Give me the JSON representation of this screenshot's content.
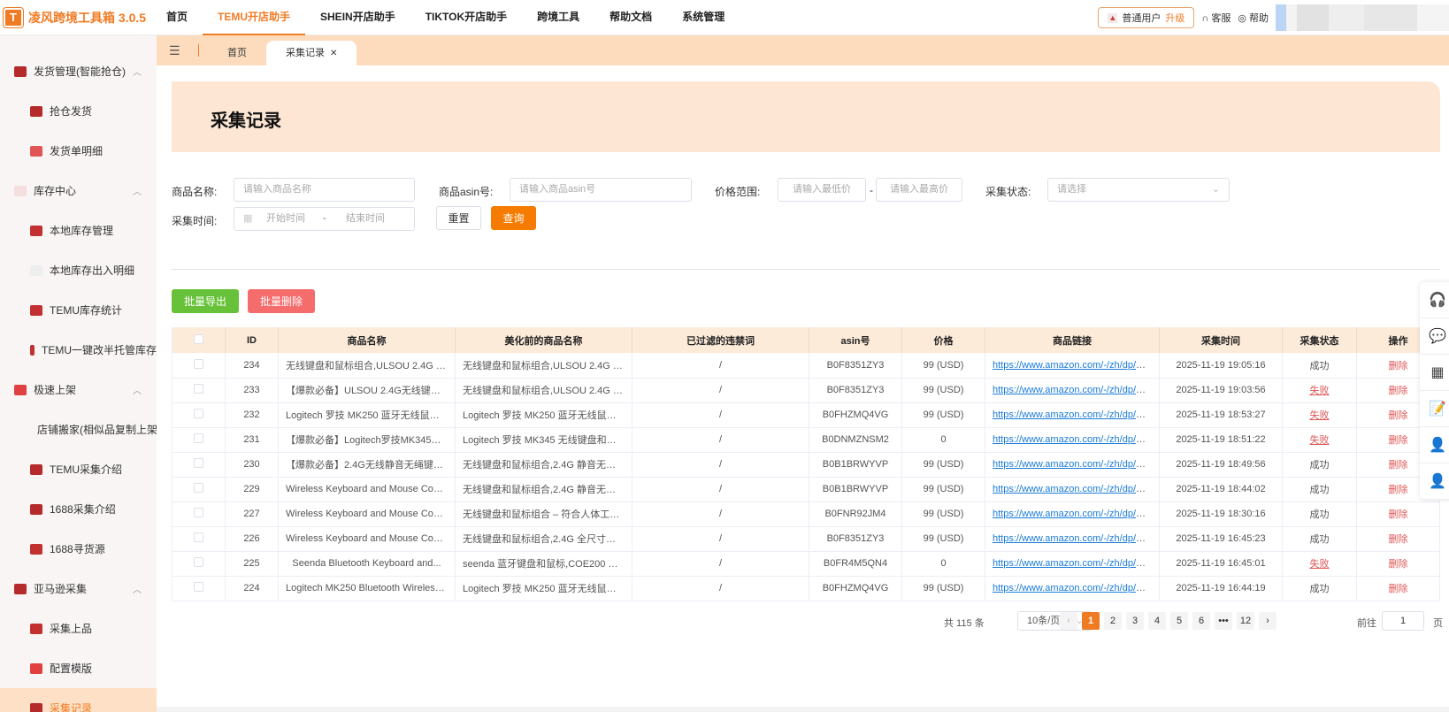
{
  "app": {
    "logo_letter": "T",
    "title": "凌风跨境工具箱 3.0.5"
  },
  "topnav": [
    {
      "label": "首页",
      "active": false
    },
    {
      "label": "TEMU开店助手",
      "active": true
    },
    {
      "label": "SHEIN开店助手",
      "active": false
    },
    {
      "label": "TIKTOK开店助手",
      "active": false
    },
    {
      "label": "跨境工具",
      "active": false
    },
    {
      "label": "帮助文档",
      "active": false
    },
    {
      "label": "系统管理",
      "active": false
    }
  ],
  "user": {
    "role": "普通用户",
    "upgrade": "升级",
    "service": "客服",
    "help": "帮助"
  },
  "sidebar": [
    {
      "label": "发货管理(智能抢仓)",
      "type": "group",
      "icon": "shipping-icon",
      "expanded": true
    },
    {
      "label": "抢仓发货",
      "type": "child",
      "icon": "box-icon"
    },
    {
      "label": "发货单明细",
      "type": "child",
      "icon": "chart-icon"
    },
    {
      "label": "库存中心",
      "type": "group",
      "icon": "list-icon",
      "expanded": true
    },
    {
      "label": "本地库存管理",
      "type": "child",
      "icon": "warehouse-icon"
    },
    {
      "label": "本地库存出入明细",
      "type": "child",
      "icon": "inout-icon"
    },
    {
      "label": "TEMU库存统计",
      "type": "child",
      "icon": "stats-icon"
    },
    {
      "label": "TEMU一键改半托管库存",
      "type": "child",
      "icon": "stats-icon"
    },
    {
      "label": "极速上架",
      "type": "group",
      "icon": "upload-icon",
      "expanded": true
    },
    {
      "label": "店铺搬家(相似品复制上架)",
      "type": "child",
      "icon": "copy-icon"
    },
    {
      "label": "TEMU采集介绍",
      "type": "child",
      "icon": "collect-icon"
    },
    {
      "label": "1688采集介绍",
      "type": "child",
      "icon": "collect-icon"
    },
    {
      "label": "1688寻货源",
      "type": "child",
      "icon": "source-icon"
    },
    {
      "label": "亚马逊采集",
      "type": "group",
      "icon": "collect-icon",
      "expanded": true
    },
    {
      "label": "采集上品",
      "type": "child",
      "icon": "source-icon"
    },
    {
      "label": "配置模版",
      "type": "child",
      "icon": "upload-icon"
    },
    {
      "label": "采集记录",
      "type": "child",
      "icon": "collect-icon",
      "active": true
    }
  ],
  "tabs": [
    {
      "label": "首页",
      "active": false
    },
    {
      "label": "采集记录",
      "active": true,
      "closable": true
    }
  ],
  "page": {
    "title": "采集记录"
  },
  "filters": {
    "name_label": "商品名称:",
    "name_placeholder": "请输入商品名称",
    "asin_label": "商品asin号:",
    "asin_placeholder": "请输入商品asin号",
    "price_label": "价格范围:",
    "price_min_placeholder": "请输入最低价",
    "price_sep": "-",
    "price_max_placeholder": "请输入最高价",
    "status_label": "采集状态:",
    "status_placeholder": "请选择",
    "time_label": "采集时间:",
    "time_start": "开始时间",
    "time_sep": "-",
    "time_end": "结束时间",
    "reset": "重置",
    "query": "查询"
  },
  "actions": {
    "export": "批量导出",
    "delete": "批量删除"
  },
  "table": {
    "headers": [
      "ID",
      "商品名称",
      "美化前的商品名称",
      "已过滤的违禁词",
      "asin号",
      "价格",
      "商品链接",
      "采集时间",
      "采集状态",
      "操作"
    ],
    "rows": [
      {
        "id": "234",
        "name": "无线键盘和鼠标组合,ULSOU 2.4G 全...",
        "orig": "无线键盘和鼠标组合,ULSOU 2.4G 全...",
        "filtered": "/",
        "asin": "B0F8351ZY3",
        "price": "99  (USD)",
        "link": "https://www.amazon.com/-/zh/dp/B0D...",
        "time": "2025-11-19 19:05:16",
        "status": "成功",
        "op": "删除"
      },
      {
        "id": "233",
        "name": "【爆款必备】ULSOU 2.4G无线键盘鼠...",
        "orig": "无线键盘和鼠标组合,ULSOU 2.4G 全...",
        "filtered": "/",
        "asin": "B0F8351ZY3",
        "price": "99  (USD)",
        "link": "https://www.amazon.com/-/zh/dp/B0D...",
        "time": "2025-11-19 19:03:56",
        "status": "失败",
        "op": "删除"
      },
      {
        "id": "232",
        "name": "Logitech 罗技 MK250 蓝牙无线鼠标和...",
        "orig": "Logitech 罗技 MK250 蓝牙无线鼠标和...",
        "filtered": "/",
        "asin": "B0FHZMQ4VG",
        "price": "99  (USD)",
        "link": "https://www.amazon.com/-/zh/dp/B0F...",
        "time": "2025-11-19 18:53:27",
        "status": "失败",
        "op": "删除"
      },
      {
        "id": "231",
        "name": "【爆款必备】Logitech罗技MK345无线...",
        "orig": "Logitech 罗技 MK345 无线键盘和鼠标...",
        "filtered": "/",
        "asin": "B0DNMZNSM2",
        "price": "0",
        "link": "https://www.amazon.com/-/zh/dp/B0D...",
        "time": "2025-11-19 18:51:22",
        "status": "失败",
        "op": "删除"
      },
      {
        "id": "230",
        "name": "【爆款必备】2.4G无线静音无绳键盘...",
        "orig": "无线键盘和鼠标组合,2.4G 静音无绳键...",
        "filtered": "/",
        "asin": "B0B1BRWYVP",
        "price": "99  (USD)",
        "link": "https://www.amazon.com/-/zh/dp/B0B...",
        "time": "2025-11-19 18:49:56",
        "status": "成功",
        "op": "删除"
      },
      {
        "id": "229",
        "name": "Wireless Keyboard and Mouse Comb...",
        "orig": "无线键盘和鼠标组合,2.4G 静音无绳键...",
        "filtered": "/",
        "asin": "B0B1BRWYVP",
        "price": "99  (USD)",
        "link": "https://www.amazon.com/-/zh/dp/B0B...",
        "time": "2025-11-19 18:44:02",
        "status": "成功",
        "op": "删除"
      },
      {
        "id": "227",
        "name": "Wireless Keyboard and Mouse Comb...",
        "orig": "无线键盘和鼠标组合 – 符合人体工程...",
        "filtered": "/",
        "asin": "B0FNR92JM4",
        "price": "99  (USD)",
        "link": "https://www.amazon.com/-/zh/dp/B0D...",
        "time": "2025-11-19 18:30:16",
        "status": "成功",
        "op": "删除"
      },
      {
        "id": "226",
        "name": "Wireless Keyboard and Mouse Comb...",
        "orig": "无线键盘和鼠标组合,2.4G 全尺寸波浪...",
        "filtered": "/",
        "asin": "B0F8351ZY3",
        "price": "99  (USD)",
        "link": "https://www.amazon.com/-/zh/dp/B0D...",
        "time": "2025-11-19 16:45:23",
        "status": "成功",
        "op": "删除"
      },
      {
        "id": "225",
        "name": "Seenda Bluetooth Keyboard and...",
        "orig": "seenda 蓝牙键盘和鼠标,COE200 US...",
        "filtered": "/",
        "asin": "B0FR4M5QN4",
        "price": "0",
        "link": "https://www.amazon.com/-/zh/dp/B0F...",
        "time": "2025-11-19 16:45:01",
        "status": "失败",
        "op": "删除"
      },
      {
        "id": "224",
        "name": "Logitech MK250 Bluetooth Wireless...",
        "orig": "Logitech 罗技 MK250 蓝牙无线鼠标和...",
        "filtered": "/",
        "asin": "B0FHZMQ4VG",
        "price": "99  (USD)",
        "link": "https://www.amazon.com/-/zh/dp/B0F...",
        "time": "2025-11-19 16:44:19",
        "status": "成功",
        "op": "删除"
      }
    ]
  },
  "pagination": {
    "total": "共 115 条",
    "page_size": "10条/页",
    "pages": [
      "1",
      "2",
      "3",
      "4",
      "5",
      "6",
      "•••",
      "12"
    ],
    "current": "1",
    "goto_label": "前往",
    "goto_value": "1",
    "goto_suffix": "页",
    "prev": "‹",
    "next": "›"
  },
  "float_panel": [
    "headset-icon",
    "wechat-icon",
    "qrcode-icon",
    "document-edit-icon",
    "user-settings-icon",
    "user-check-icon"
  ],
  "colors": {
    "accent": "#f07b25",
    "success_btn": "#67c23a",
    "danger_btn": "#f56c6c",
    "fail": "#e05555",
    "link": "#1a7bd6"
  }
}
